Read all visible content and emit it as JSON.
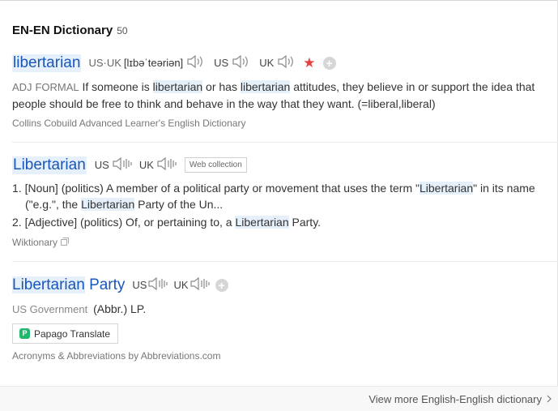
{
  "header": {
    "title": "EN-EN Dictionary",
    "count": "50"
  },
  "entry1": {
    "headword": "libertarian",
    "pron_label": "US·UK",
    "phonetic": "[lɪbəˈteəriən]",
    "us_label": "US",
    "uk_label": "UK",
    "pos": "ADJ",
    "register": "FORMAL",
    "def_1": " If someone is ",
    "def_hl1": "libertarian",
    "def_2": " or has ",
    "def_hl2": "libertarian",
    "def_3": " attitudes, they believe in or support the idea that people should be free to think and behave in the way that they want. (=liberal,liberal)",
    "source": "Collins Cobuild Advanced Learner's English Dictionary"
  },
  "entry2": {
    "headword": "Libertarian",
    "us_label": "US",
    "uk_label": "UK",
    "web_collection": "Web collection",
    "d1_a": "1. [Noun] (politics) A member of a political party or movement that uses the term \"",
    "d1_hl1": "Libertarian",
    "d1_b": "\" in its name (\"e.g.\", the ",
    "d1_hl2": "Libertarian",
    "d1_c": " Party of the Un...",
    "d2_a": "2. [Adjective] (politics) Of, or pertaining to, a ",
    "d2_hl": "Libertarian",
    "d2_b": " Party.",
    "source": "Wiktionary"
  },
  "entry3": {
    "headword_hl": "Libertarian",
    "headword_rest": "Party",
    "us_label": "US",
    "uk_label": "UK",
    "pos": "US Government",
    "def": "(Abbr.) LP.",
    "papago_label": "Papago Translate",
    "source": "Acronyms & Abbreviations by Abbreviations.com"
  },
  "footer": {
    "more_link": "View more English-English dictionary"
  },
  "icons": [
    "speaker-icon",
    "star-icon",
    "plus-icon",
    "copy-icon",
    "chevron-right-icon",
    "papago-icon"
  ],
  "colors": {
    "accent": "#1a56b8",
    "highlight": "#e6f0fb",
    "star": "#e54141"
  }
}
